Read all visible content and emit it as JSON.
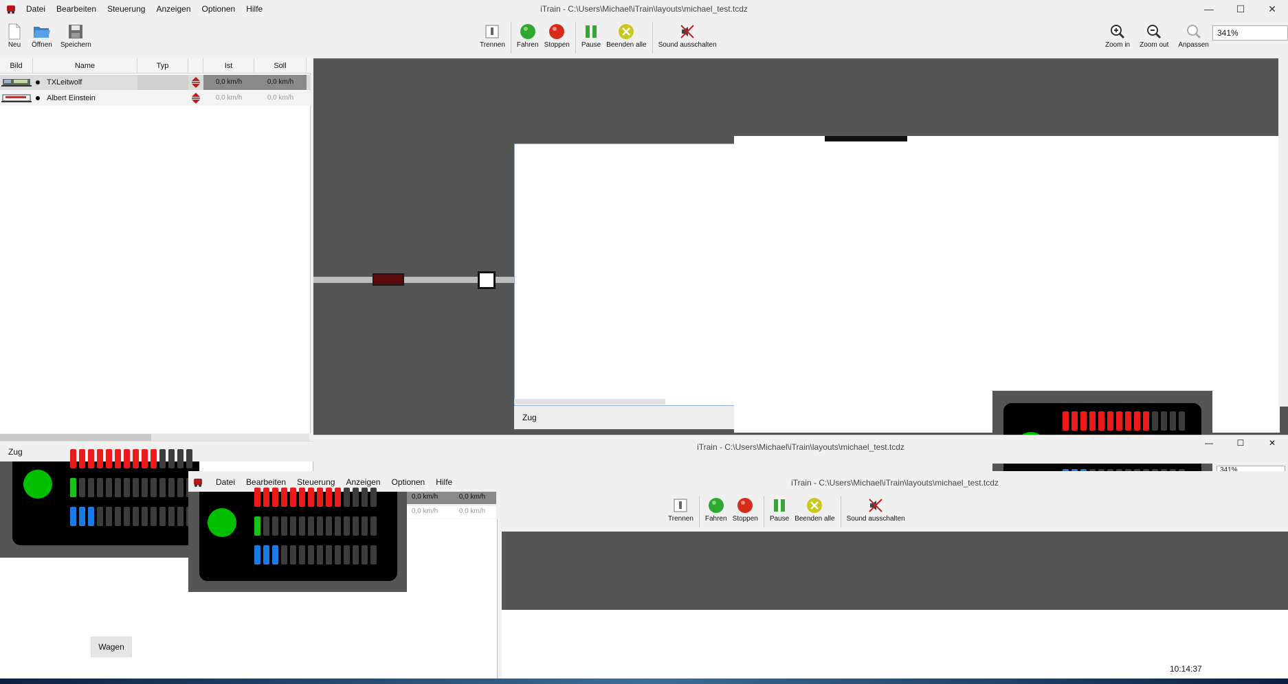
{
  "window": {
    "title": "iTrain - C:\\Users\\Michael\\iTrain\\layouts\\michael_test.tcdz",
    "minimize": "—",
    "maximize": "☐",
    "close": "✕"
  },
  "menu": [
    "Datei",
    "Bearbeiten",
    "Steuerung",
    "Anzeigen",
    "Optionen",
    "Hilfe"
  ],
  "toolbar_left": [
    {
      "label": "Neu",
      "icon": "new-file-icon"
    },
    {
      "label": "Öffnen",
      "icon": "open-folder-icon"
    },
    {
      "label": "Speichern",
      "icon": "save-disk-icon"
    }
  ],
  "toolbar_center": [
    {
      "label": "Trennen",
      "icon": "disconnect-icon"
    },
    {
      "label": "Fahren",
      "icon": "green-go-icon",
      "color": "#2fa82f"
    },
    {
      "label": "Stoppen",
      "icon": "red-stop-icon",
      "color": "#d62a1a"
    },
    {
      "label": "Pause",
      "icon": "pause-icon",
      "color": "#3aa33a"
    },
    {
      "label": "Beenden alle",
      "icon": "end-all-icon",
      "color": "#c8c81e"
    },
    {
      "label": "Sound ausschalten",
      "icon": "sound-off-icon"
    }
  ],
  "toolbar_right": [
    {
      "label": "Zoom in",
      "icon": "zoom-in-icon"
    },
    {
      "label": "Zoom out",
      "icon": "zoom-out-icon"
    },
    {
      "label": "Anpassen",
      "icon": "fit-zoom-icon"
    }
  ],
  "zoom_value": "341%",
  "zoom_value_partial": "341%",
  "table": {
    "headers": [
      "Bild",
      "Name",
      "Typ",
      "",
      "Ist",
      "Soll"
    ],
    "rows": [
      {
        "name": "TXLeitwolf",
        "ist": "0,0 km/h",
        "soll": "0,0 km/h",
        "selected": true
      },
      {
        "name": "Albert Einstein",
        "ist": "0,0 km/h",
        "soll": "0,0 km/h",
        "selected": false
      }
    ]
  },
  "tabs": {
    "zug": "Zug",
    "wagen": "Wagen"
  },
  "clock": "10:14:37",
  "colors": {
    "track_bg": "#555555",
    "led_red": "#ee1a1a",
    "led_green": "#19c219",
    "led_blue": "#1a7be6",
    "led_off": "#3c3c3c",
    "go_green": "#00c000"
  }
}
